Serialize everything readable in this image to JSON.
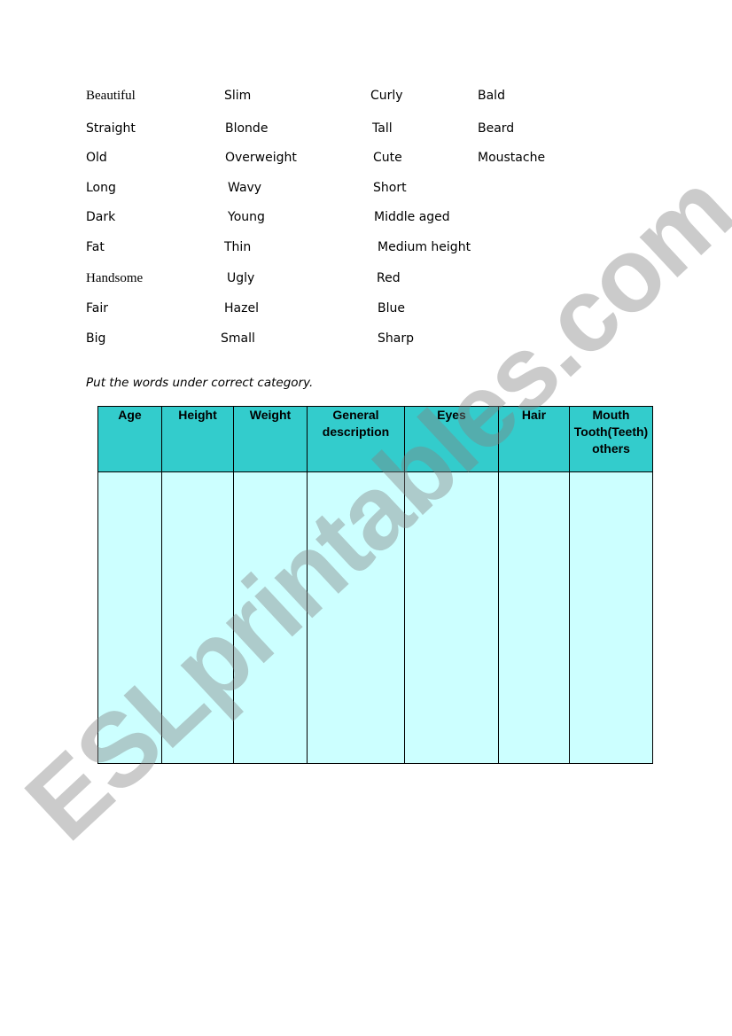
{
  "word_bank": {
    "rows": [
      [
        "Beautiful",
        "Slim",
        "Curly",
        "Bald"
      ],
      [
        "Straight",
        "Blonde",
        "Tall",
        "Beard"
      ],
      [
        "Old",
        "Overweight",
        "Cute",
        "Moustache"
      ],
      [
        "Long",
        "Wavy",
        "Short"
      ],
      [
        "Dark",
        "Young",
        "Middle aged"
      ],
      [
        "Fat",
        "Thin",
        "Medium height"
      ],
      [
        "Handsome",
        "Ugly",
        "Red"
      ],
      [
        "Fair",
        "Hazel",
        "Blue"
      ],
      [
        "Big",
        "Small",
        "Sharp"
      ]
    ]
  },
  "instruction": "Put the words under correct category.",
  "table": {
    "headers": [
      "Age",
      "Height",
      "Weight",
      "General\ndescription",
      "Eyes",
      "Hair",
      "Mouth\nTooth(Teeth)\nothers"
    ],
    "header_color": "#33cccc",
    "cell_color": "#ccffff"
  },
  "watermark": "ESLprintables.com"
}
